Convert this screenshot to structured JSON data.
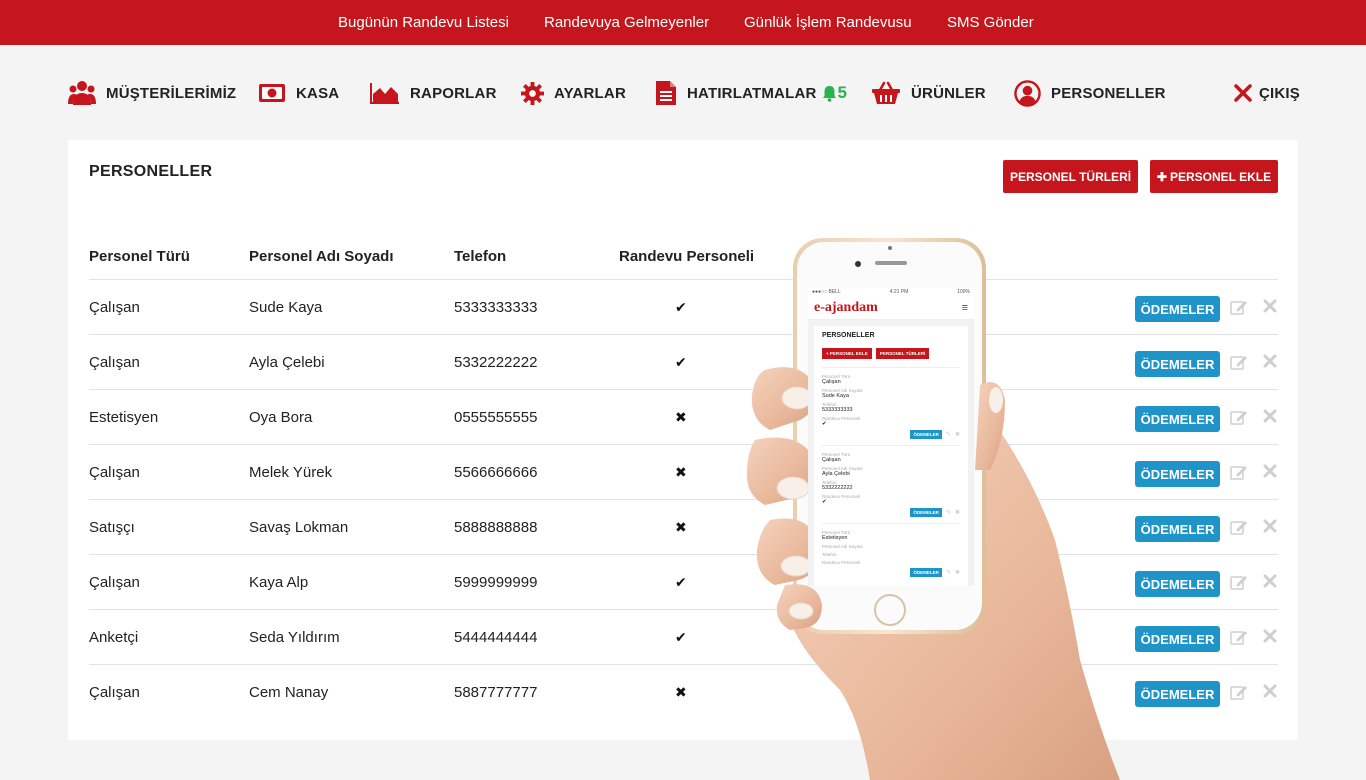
{
  "topnav": [
    "Bugünün Randevu Listesi",
    "Randevuya Gelmeyenler",
    "Günlük İşlem Randevusu",
    "SMS Gönder"
  ],
  "mainnav": {
    "customers": "MÜŞTERİLERİMİZ",
    "cash": "KASA",
    "reports": "RAPORLAR",
    "settings": "AYARLAR",
    "reminders": "HATIRLATMALAR",
    "reminder_count": "5",
    "products": "ÜRÜNLER",
    "staff": "PERSONELLER",
    "logout": "ÇIKIŞ"
  },
  "panel": {
    "title": "PERSONELLER",
    "btn_types": "PERSONEL TÜRLERİ",
    "btn_add": "PERSONEL EKLE",
    "btn_add_icon": "✚"
  },
  "table": {
    "headers": [
      "Personel Türü",
      "Personel Adı Soyadı",
      "Telefon",
      "Randevu Personeli"
    ],
    "pay_label": "ÖDEMELER",
    "rows": [
      {
        "type": "Çalışan",
        "name": "Sude Kaya",
        "phone": "5333333333",
        "appointment": "✔"
      },
      {
        "type": "Çalışan",
        "name": "Ayla Çelebi",
        "phone": "5332222222",
        "appointment": "✔"
      },
      {
        "type": "Estetisyen",
        "name": "Oya Bora",
        "phone": "0555555555",
        "appointment": "✖"
      },
      {
        "type": "Çalışan",
        "name": "Melek Yürek",
        "phone": "5566666666",
        "appointment": "✖"
      },
      {
        "type": "Satışçı",
        "name": "Savaş Lokman",
        "phone": "5888888888",
        "appointment": "✖"
      },
      {
        "type": "Çalışan",
        "name": "Kaya Alp",
        "phone": "5999999999",
        "appointment": "✔"
      },
      {
        "type": "Anketçi",
        "name": "Seda Yıldırım",
        "phone": "5444444444",
        "appointment": "✔"
      },
      {
        "type": "Çalışan",
        "name": "Cem Nanay",
        "phone": "5887777777",
        "appointment": "✖"
      }
    ]
  },
  "phone": {
    "carrier": "●●●○○ BELL",
    "time": "4:21 PM",
    "battery": "100%",
    "logo": "e-ajandam",
    "menu": "≡",
    "title": "PERSONELLER",
    "btn_add": "+ PERSONEL EKLE",
    "btn_types": "PERSONEL TÜRLERİ",
    "lab_type": "Personel Türü",
    "lab_name": "Personel Adı Soyadı",
    "lab_phone": "Telefon",
    "lab_app": "Randevu Personeli",
    "pay": "ÖDEMELER",
    "edit": "✎",
    "del": "✖",
    "records": [
      {
        "type": "Çalışan",
        "name": "Sude Kaya",
        "phone": "5333333333",
        "app": "✔"
      },
      {
        "type": "Çalışan",
        "name": "Ayla Çelebi",
        "phone": "5332222222",
        "app": "✔"
      },
      {
        "type": "Estetisyen",
        "name": "",
        "phone": "",
        "app": ""
      }
    ]
  },
  "colors": {
    "brand_red": "#c4161c",
    "button_blue": "#1f94c8",
    "badge_green": "#2bb24c",
    "page_bg": "#f4f4f4"
  },
  "icons": [
    "users-icon",
    "cash-icon",
    "chart-icon",
    "gear-icon",
    "document-icon",
    "bell-icon",
    "basket-icon",
    "user-circle-icon",
    "close-icon",
    "check-icon",
    "edit-icon",
    "delete-icon"
  ]
}
